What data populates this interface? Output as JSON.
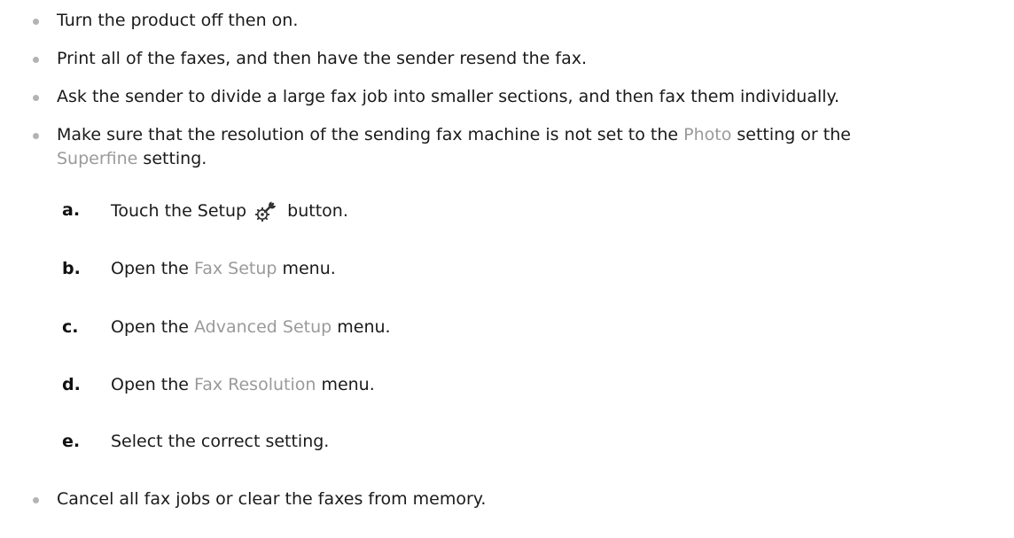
{
  "bullets": [
    {
      "text": "Turn the product off then on."
    },
    {
      "text": "Print all of the faxes, and then have the sender resend the fax."
    },
    {
      "text": "Ask the sender to divide a large fax job into smaller sections, and then fax them individually."
    },
    {
      "line1_prefix": "Make sure that the resolution of the sending fax machine is not set to the ",
      "line1_ref": "Photo",
      "line1_suffix": " setting or the",
      "line2_ref": "Superfine",
      "line2_suffix": " setting."
    },
    {
      "text": "Cancel all fax jobs or clear the faxes from memory."
    }
  ],
  "steps": [
    {
      "letter": "a.",
      "prefix": "Touch the Setup ",
      "icon": "setup-wrench-gear-icon",
      "suffix": " button."
    },
    {
      "letter": "b.",
      "prefix": "Open the ",
      "ref": "Fax Setup",
      "suffix": " menu."
    },
    {
      "letter": "c.",
      "prefix": "Open the ",
      "ref": "Advanced Setup",
      "suffix": " menu."
    },
    {
      "letter": "d.",
      "prefix": "Open the ",
      "ref": "Fax Resolution",
      "suffix": " menu."
    },
    {
      "letter": "e.",
      "text": "Select the correct setting."
    }
  ],
  "colors": {
    "text": "#1a1a1a",
    "ui_reference": "#9a9a9a",
    "bullet": "#b3b3b3"
  }
}
